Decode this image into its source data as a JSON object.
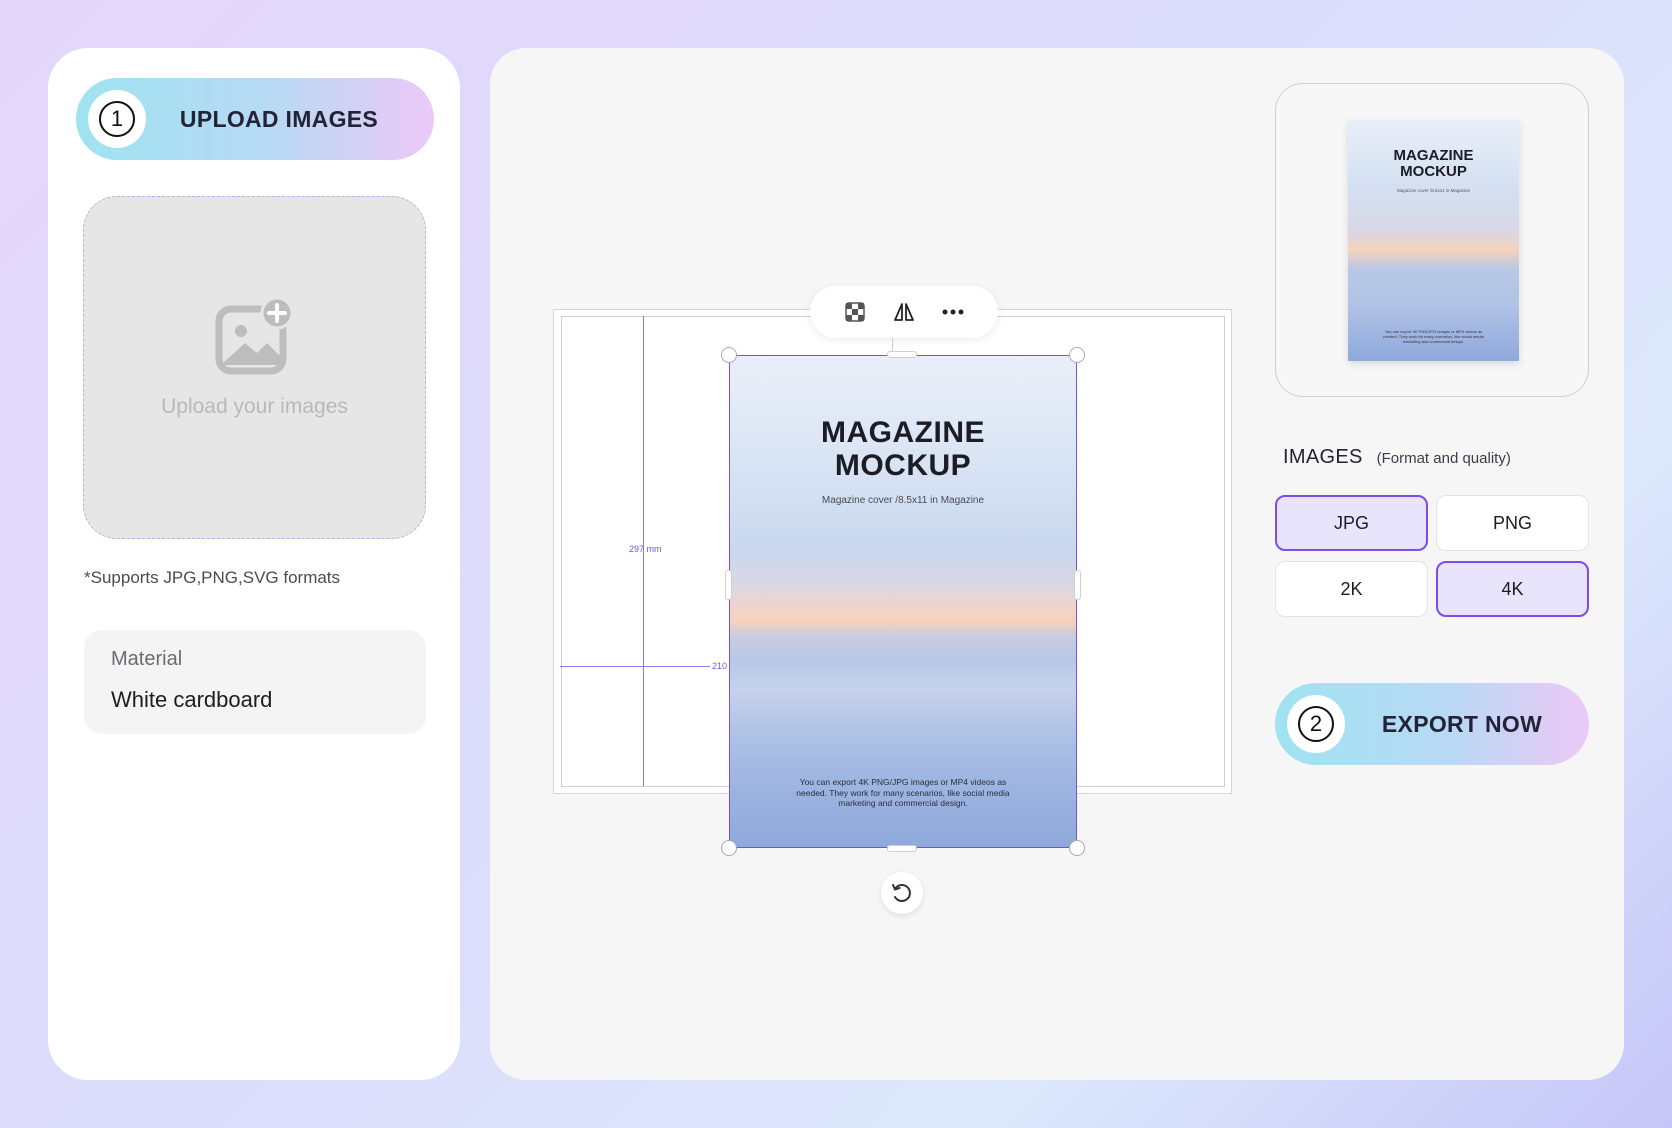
{
  "upload_step": {
    "number": "1",
    "label": "UPLOAD IMAGES"
  },
  "dropzone": {
    "text": "Upload your images",
    "icon": "image-add-icon"
  },
  "formats_note": "*Supports JPG,PNG,SVG formats",
  "material": {
    "label": "Material",
    "value": "White cardboard"
  },
  "canvas": {
    "dimension_height": "297 mm",
    "dimension_width": "210",
    "toolbar_icons": [
      "transparency-icon",
      "flip-icon",
      "more-icon"
    ],
    "poster": {
      "title_line1": "MAGAZINE",
      "title_line2": "MOCKUP",
      "subtitle": "Magazine cover /8.5x11 in Magazine",
      "footer": "You can export 4K PNG/JPG images or MP4 videos as needed. They work for many scenarios, like social media marketing and commercial design."
    }
  },
  "preview": {
    "title_line1": "MAGAZINE",
    "title_line2": "MOCKUP",
    "subtitle": "Magazine cover /8.5x11 in Magazine",
    "footer": "You can export 4K PNG/JPG images or MP4 videos as needed. They work for many scenarios, like social media marketing and commercial design."
  },
  "images": {
    "title": "IMAGES",
    "subtitle": "(Format and quality)"
  },
  "formats": [
    {
      "label": "JPG",
      "selected": true
    },
    {
      "label": "PNG",
      "selected": false
    }
  ],
  "qualities": [
    {
      "label": "2K",
      "selected": false
    },
    {
      "label": "4K",
      "selected": true
    }
  ],
  "export_step": {
    "number": "2",
    "label": "EXPORT NOW"
  },
  "colors": {
    "accent": "#7b4ee8",
    "selected_bg": "#e8e4fb"
  }
}
